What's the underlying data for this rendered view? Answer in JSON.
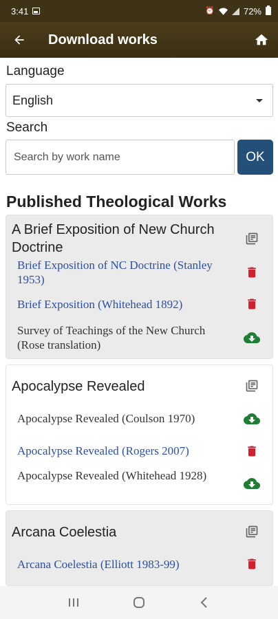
{
  "status": {
    "time": "3:41",
    "battery": "72%"
  },
  "appbar": {
    "title": "Download works"
  },
  "language": {
    "label": "Language",
    "selected": "English"
  },
  "search": {
    "label": "Search",
    "placeholder": "Search by work name",
    "ok_label": "OK"
  },
  "section_title": "Published Theological Works",
  "groups": [
    {
      "title": "A Brief Exposition of New Church Doctrine",
      "works": [
        {
          "name": "Brief Exposition of NC Doctrine (Stanley 1953)",
          "downloaded": true
        },
        {
          "name": "Brief Exposition (Whitehead 1892)",
          "downloaded": true
        },
        {
          "name": "Survey of Teachings of the New Church (Rose translation)",
          "downloaded": false
        }
      ]
    },
    {
      "title": "Apocalypse Revealed",
      "works": [
        {
          "name": "Apocalypse Revealed (Coulson 1970)",
          "downloaded": false
        },
        {
          "name": "Apocalypse Revealed (Rogers 2007)",
          "downloaded": true
        },
        {
          "name": "Apocalypse Revealed (Whitehead 1928)",
          "downloaded": false
        }
      ]
    },
    {
      "title": "Arcana Coelestia",
      "works": [
        {
          "name": "Arcana Coelestia (Elliott 1983-99)",
          "downloaded": true
        }
      ]
    }
  ],
  "colors": {
    "appbar": "#3f3317",
    "ok_button": "#234f78",
    "delete": "#d0212f",
    "download": "#1e7e34",
    "link": "#2b4fa8"
  },
  "icons": {
    "back": "arrow-left-icon",
    "home": "home-icon",
    "library": "library-books-icon",
    "delete": "trash-icon",
    "download": "cloud-download-icon"
  }
}
